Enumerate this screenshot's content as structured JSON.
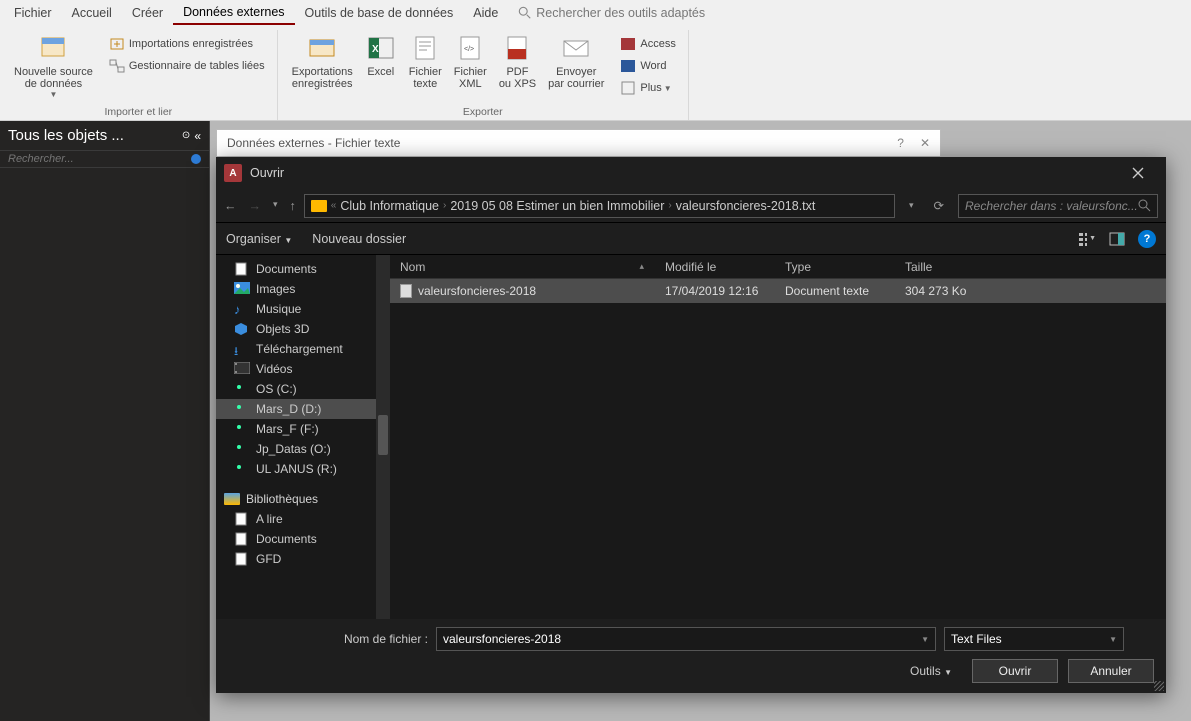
{
  "menubar": {
    "items": [
      "Fichier",
      "Accueil",
      "Créer",
      "Données externes",
      "Outils de base de données",
      "Aide"
    ],
    "active_index": 3,
    "search_placeholder": "Rechercher des outils adaptés"
  },
  "ribbon": {
    "group1": {
      "big_btn": "Nouvelle source\nde données",
      "small": [
        "Importations enregistrées",
        "Gestionnaire de tables liées"
      ],
      "label": "Importer et lier"
    },
    "group2": {
      "btns": [
        "Exportations\nenregistrées",
        "Excel",
        "Fichier\ntexte",
        "Fichier\nXML",
        "PDF\nou XPS",
        "Envoyer\npar courrier"
      ],
      "side": [
        "Access",
        "Word",
        "Plus"
      ],
      "label": "Exporter"
    }
  },
  "left_panel": {
    "title": "Tous les objets ...",
    "search_placeholder": "Rechercher..."
  },
  "wizard": {
    "title": "Données externes - Fichier texte"
  },
  "filedlg": {
    "title": "Ouvrir",
    "breadcrumb": [
      "Club Informatique",
      "2019 05 08 Estimer un bien Immobilier",
      "valeursfoncieres-2018.txt"
    ],
    "search_placeholder": "Rechercher dans : valeursfonc...",
    "organiser": "Organiser",
    "new_folder": "Nouveau dossier",
    "columns": {
      "name": "Nom",
      "date": "Modifié le",
      "type": "Type",
      "size": "Taille"
    },
    "tree": [
      {
        "label": "Documents",
        "icon": "doc"
      },
      {
        "label": "Images",
        "icon": "img"
      },
      {
        "label": "Musique",
        "icon": "music"
      },
      {
        "label": "Objets 3D",
        "icon": "3d"
      },
      {
        "label": "Téléchargement",
        "icon": "dl"
      },
      {
        "label": "Vidéos",
        "icon": "vid"
      },
      {
        "label": "OS (C:)",
        "icon": "drive"
      },
      {
        "label": "Mars_D (D:)",
        "icon": "drive",
        "selected": true
      },
      {
        "label": "Mars_F (F:)",
        "icon": "drive"
      },
      {
        "label": "Jp_Datas (O:)",
        "icon": "drive"
      },
      {
        "label": "UL JANUS (R:)",
        "icon": "drive"
      }
    ],
    "tree_section": "Bibliothèques",
    "tree2": [
      {
        "label": "A lire",
        "icon": "doc"
      },
      {
        "label": "Documents",
        "icon": "doc"
      },
      {
        "label": "GFD",
        "icon": "doc"
      }
    ],
    "file": {
      "name": "valeursfoncieres-2018",
      "date": "17/04/2019 12:16",
      "type": "Document texte",
      "size": "304 273 Ko"
    },
    "fname_label": "Nom de fichier :",
    "fname_value": "valeursfoncieres-2018",
    "filter": "Text Files",
    "tools": "Outils",
    "open": "Ouvrir",
    "cancel": "Annuler"
  }
}
